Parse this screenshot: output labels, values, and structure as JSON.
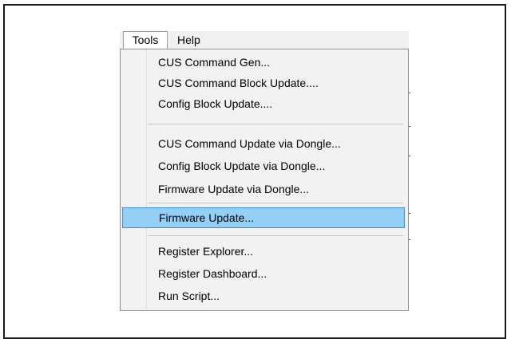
{
  "menubar": {
    "items": [
      {
        "label": "Tools"
      },
      {
        "label": "Help"
      }
    ]
  },
  "tools_menu": {
    "groups": [
      [
        "CUS Command Gen...",
        "CUS Command Block Update....",
        "Config Block Update...."
      ],
      [
        "CUS Command Update via Dongle...",
        "Config Block Update via Dongle...",
        "Firmware Update via Dongle..."
      ],
      [
        "Firmware Update..."
      ],
      [
        "Register Explorer...",
        "Register Dashboard...",
        "Run Script..."
      ]
    ],
    "highlighted": "Firmware Update..."
  }
}
